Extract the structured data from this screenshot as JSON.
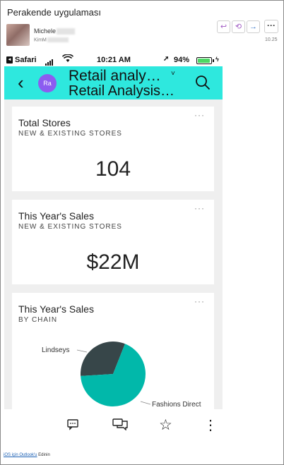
{
  "email": {
    "subject": "Perakende uygulaması",
    "sender_name": "Michele",
    "sender_addr": "KimM",
    "time": "10.25",
    "actions": {
      "reply": "↩",
      "reply_all": "⟲",
      "forward": "→",
      "more": "···"
    }
  },
  "status_bar": {
    "back": "◂",
    "carrier": "Safari",
    "time": "10:21 AM",
    "battery_text": "94%",
    "battery_level": 0.94,
    "location_icon": "➚",
    "wifi_icon": "wifi-icon",
    "bolt": "ϟ"
  },
  "app_bar": {
    "back_icon": "‹",
    "workspace_initials": "Ra",
    "title_line1": "Retail analy…",
    "title_line2": "Retail Analysis…",
    "title_chevron": "˅",
    "accent": "#2ee8de",
    "avatar_color": "#8c5cf0"
  },
  "cards": {
    "total_stores": {
      "title": "Total Stores",
      "subtitle": "NEW & EXISTING STORES",
      "value": "104",
      "more": "···"
    },
    "sales": {
      "title": "This Year's Sales",
      "subtitle": "NEW & EXISTING STORES",
      "value": "$22M",
      "more": "···"
    },
    "by_chain": {
      "title": "This Year's Sales",
      "subtitle": "BY CHAIN",
      "more": "···"
    }
  },
  "chart_data": {
    "type": "pie",
    "title": "This Year's Sales",
    "subtitle": "BY CHAIN",
    "series": [
      {
        "label": "Fashions Direct",
        "value": 68,
        "color": "#01b8aa"
      },
      {
        "label": "Lindseys",
        "value": 32,
        "color": "#374649"
      }
    ]
  },
  "bottom_bar": {
    "comment_icon": "⎚",
    "conversation_icon": "⧉",
    "favorite_icon": "☆",
    "more_icon": "⋮"
  },
  "footer": {
    "link_text": "iOS için Outlook'u",
    "suffix": " Edinin"
  }
}
